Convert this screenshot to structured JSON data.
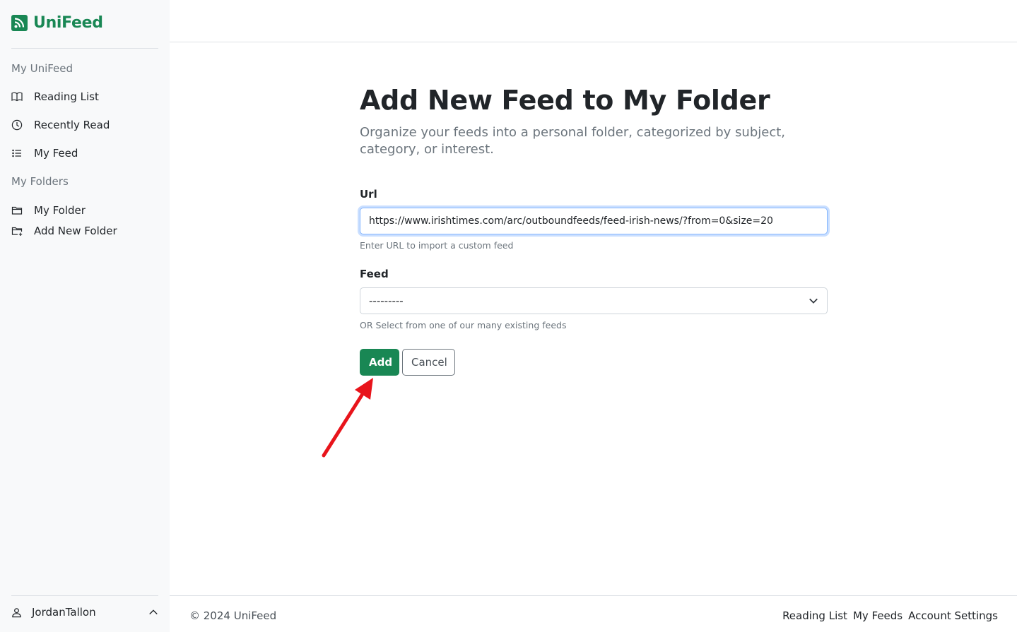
{
  "app": {
    "name": "UniFeed"
  },
  "sidebar": {
    "section_unifeed": "My UniFeed",
    "items": [
      {
        "label": "Reading List",
        "icon": "book-icon"
      },
      {
        "label": "Recently Read",
        "icon": "clock-icon"
      },
      {
        "label": "My Feed",
        "icon": "list-icon"
      }
    ],
    "section_folders": "My Folders",
    "folders": [
      {
        "label": "My Folder",
        "icon": "folder-icon"
      },
      {
        "label": "Add New Folder",
        "icon": "folder-plus-icon"
      }
    ],
    "user": {
      "name": "JordanTallon"
    }
  },
  "page": {
    "title": "Add New Feed to My Folder",
    "subtitle": "Organize your feeds into a personal folder, categorized by subject, category, or interest."
  },
  "form": {
    "url_label": "Url",
    "url_value": "https://www.irishtimes.com/arc/outboundfeeds/feed-irish-news/?from=0&size=20",
    "url_help": "Enter URL to import a custom feed",
    "feed_label": "Feed",
    "feed_selected": "---------",
    "feed_help": "OR Select from one of our many existing feeds",
    "add_label": "Add",
    "cancel_label": "Cancel"
  },
  "footer": {
    "copyright": "© 2024 UniFeed",
    "links": [
      "Reading List",
      "My Feeds",
      "Account Settings"
    ]
  },
  "colors": {
    "accent": "#198754",
    "annotation": "#e8141b"
  }
}
